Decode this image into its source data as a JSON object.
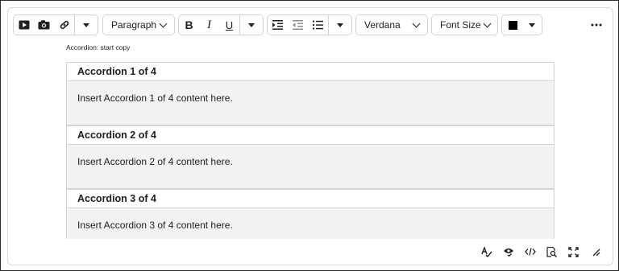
{
  "toolbar": {
    "format_block": "Paragraph",
    "font_family": "Verdana",
    "font_size": "Font Size",
    "text_color": "#000000",
    "icons": [
      "insert-media-icon",
      "insert-image-icon",
      "insert-link-icon",
      "bold-icon",
      "italic-icon",
      "underline-icon",
      "indent-icon",
      "outdent-icon",
      "bulleted-list-icon",
      "more-options-icon"
    ]
  },
  "content": {
    "marker": "Accordion: start copy",
    "accordions": [
      {
        "title": "Accordion 1 of 4",
        "body": "Insert Accordion 1 of 4 content here."
      },
      {
        "title": "Accordion 2 of 4",
        "body": "Insert Accordion 2 of 4 content here."
      },
      {
        "title": "Accordion 3 of 4",
        "body": "Insert Accordion 3 of 4 content here."
      }
    ]
  },
  "statusbar": {
    "icons": [
      "spell-check-icon",
      "accessibility-check-icon",
      "source-code-icon",
      "preview-icon",
      "fullscreen-icon",
      "resize-handle-icon"
    ]
  }
}
